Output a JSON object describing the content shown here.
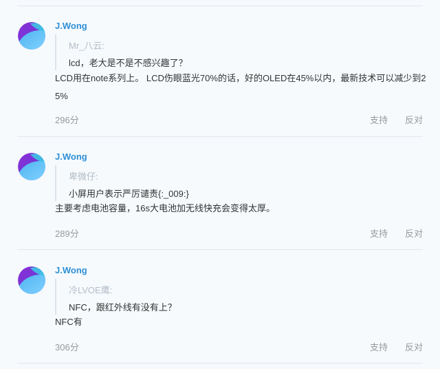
{
  "comments": [
    {
      "username": "J.Wong",
      "quote_author": "Mr_八云:",
      "quote_text": "lcd，老大是不是不感兴趣了？",
      "body": "LCD用在note系列上。 LCD伤眼蓝光70%的话，好的OLED在45%以内，最新技术可以减少到25%",
      "score": "296分",
      "support_label": "支持",
      "oppose_label": "反对"
    },
    {
      "username": "J.Wong",
      "quote_author": "卑微仔:",
      "quote_text": "小屏用户表示严厉谴责{:_009:}",
      "body": "主要考虑电池容量，16s大电池加无线快充会变得太厚。",
      "score": "289分",
      "support_label": "支持",
      "oppose_label": "反对"
    },
    {
      "username": "J.Wong",
      "quote_author": "冷LVOE鹰:",
      "quote_text": "NFC，跟红外线有没有上？",
      "body": "NFC有",
      "score": "306分",
      "support_label": "支持",
      "oppose_label": "反对"
    }
  ],
  "colors": {
    "background": "#f6fafd",
    "username": "#2f8fd6",
    "quote_author": "#b3bcc6",
    "muted": "#999999",
    "divider": "#e2e7ec"
  },
  "icons": {
    "avatar": "avatar-icon"
  }
}
